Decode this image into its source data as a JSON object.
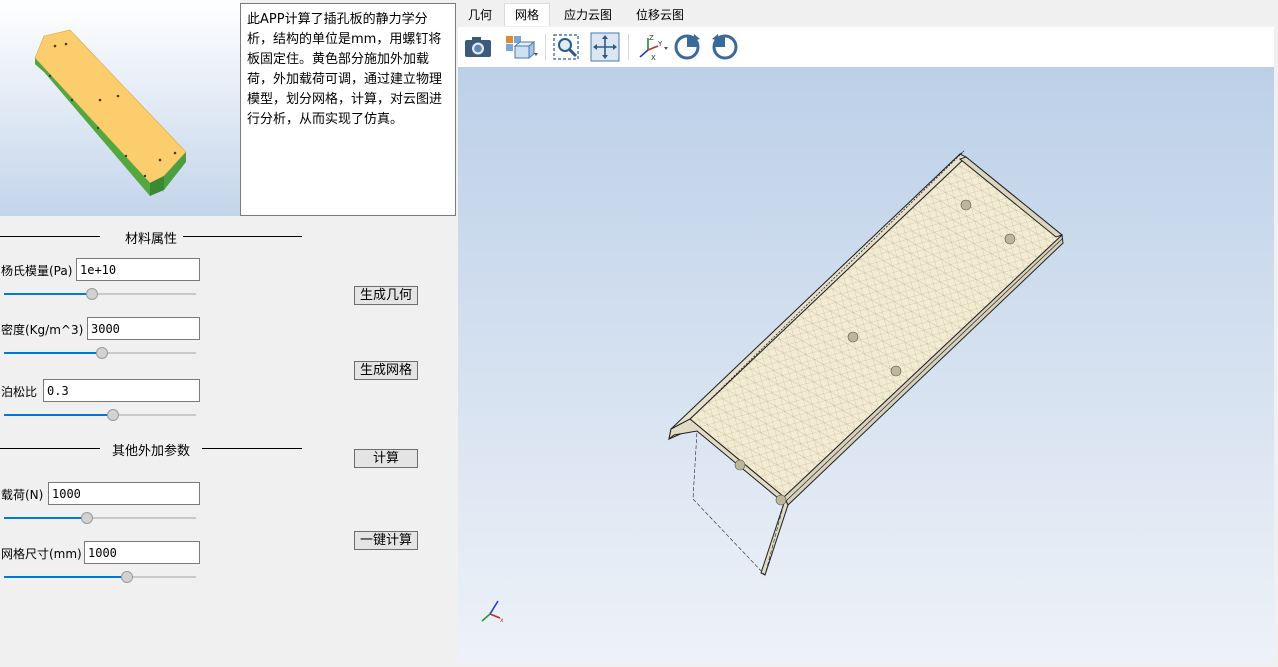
{
  "description": "此APP计算了插孔板的静力学分析，结构的单位是mm，用螺钉将板固定住。黄色部分施加外加载荷，外加载荷可调，通过建立物理模型，划分网格，计算，对云图进行分析，从而实现了仿真。",
  "material_group": {
    "title": "材料属性",
    "params": [
      {
        "label": "杨氏模量(Pa)",
        "value": "1e+10",
        "slider": 0.46
      },
      {
        "label": "密度(Kg/m^3)",
        "value": "3000",
        "slider": 0.51
      },
      {
        "label": "泊松比",
        "value": "0.3",
        "slider": 0.57
      }
    ]
  },
  "other_group": {
    "title": "其他外加参数",
    "params": [
      {
        "label": "载荷(N)",
        "value": "1000",
        "slider": 0.43
      },
      {
        "label": "网格尺寸(mm)",
        "value": "1000",
        "slider": 0.64
      }
    ]
  },
  "buttons": {
    "gen_geometry": "生成几何",
    "gen_mesh": "生成网格",
    "compute": "计算",
    "one_click": "一键计算"
  },
  "tabs": [
    {
      "label": "几何",
      "active": false
    },
    {
      "label": "网格",
      "active": true
    },
    {
      "label": "应力云图",
      "active": false
    },
    {
      "label": "位移云图",
      "active": false
    }
  ],
  "toolbar": {
    "icons": [
      "camera-icon",
      "view-cube-icon",
      "zoom-box-icon",
      "pan-fit-icon",
      "axes-orient-icon",
      "rotate-cw-icon",
      "rotate-ccw-icon"
    ]
  },
  "colors": {
    "accent": "#0078d7",
    "part_top": "#fcca68",
    "part_side": "#4aa040",
    "mesh_line": "#2a2a2a",
    "mesh_fill": "#f4ecd0"
  }
}
